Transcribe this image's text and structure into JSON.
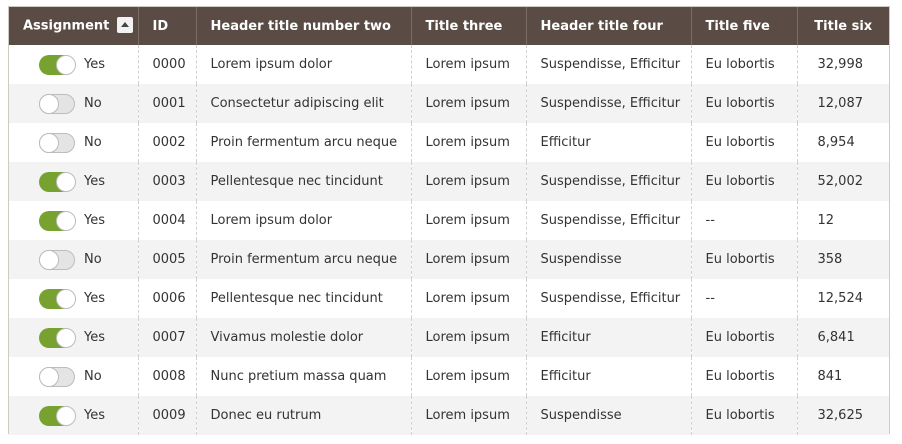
{
  "columns": {
    "assignment": "Assignment",
    "id": "ID",
    "title_two": "Header title number two",
    "title_three": "Title three",
    "title_four": "Header title four",
    "title_five": "Title five",
    "title_six": "Title six"
  },
  "sort_icon": "sort-ascending-icon",
  "colors": {
    "header_bg": "#5a4c44",
    "toggle_on": "#78a22f",
    "toggle_off": "#e4e4e4"
  },
  "rows": [
    {
      "assigned": true,
      "assign_label": "Yes",
      "id": "0000",
      "two": "Lorem ipsum dolor",
      "three": "Lorem ipsum",
      "four": "Suspendisse, Efficitur",
      "five": "Eu lobortis",
      "six": "32,998"
    },
    {
      "assigned": false,
      "assign_label": "No",
      "id": "0001",
      "two": "Consectetur adipiscing elit",
      "three": "Lorem ipsum",
      "four": "Suspendisse, Efficitur",
      "five": "Eu lobortis",
      "six": "12,087"
    },
    {
      "assigned": false,
      "assign_label": "No",
      "id": "0002",
      "two": "Proin fermentum arcu neque",
      "three": "Lorem ipsum",
      "four": "Efficitur",
      "five": "Eu lobortis",
      "six": "8,954"
    },
    {
      "assigned": true,
      "assign_label": "Yes",
      "id": "0003",
      "two": "Pellentesque nec tincidunt",
      "three": "Lorem ipsum",
      "four": "Suspendisse, Efficitur",
      "five": "Eu lobortis",
      "six": "52,002"
    },
    {
      "assigned": true,
      "assign_label": "Yes",
      "id": "0004",
      "two": "Lorem ipsum dolor",
      "three": "Lorem ipsum",
      "four": "Suspendisse, Efficitur",
      "five": "--",
      "six": "12"
    },
    {
      "assigned": false,
      "assign_label": "No",
      "id": "0005",
      "two": "Proin fermentum arcu neque",
      "three": "Lorem ipsum",
      "four": "Suspendisse",
      "five": "Eu lobortis",
      "six": "358"
    },
    {
      "assigned": true,
      "assign_label": "Yes",
      "id": "0006",
      "two": "Pellentesque nec tincidunt",
      "three": "Lorem ipsum",
      "four": "Suspendisse, Efficitur",
      "five": "--",
      "six": "12,524"
    },
    {
      "assigned": true,
      "assign_label": "Yes",
      "id": "0007",
      "two": "Vivamus molestie dolor",
      "three": "Lorem ipsum",
      "four": "Efficitur",
      "five": "Eu lobortis",
      "six": "6,841"
    },
    {
      "assigned": false,
      "assign_label": "No",
      "id": "0008",
      "two": "Nunc pretium massa quam",
      "three": "Lorem ipsum",
      "four": "Efficitur",
      "five": "Eu lobortis",
      "six": "841"
    },
    {
      "assigned": true,
      "assign_label": "Yes",
      "id": "0009",
      "two": "Donec eu rutrum",
      "three": "Lorem ipsum",
      "four": "Suspendisse",
      "five": "Eu lobortis",
      "six": "32,625"
    }
  ]
}
